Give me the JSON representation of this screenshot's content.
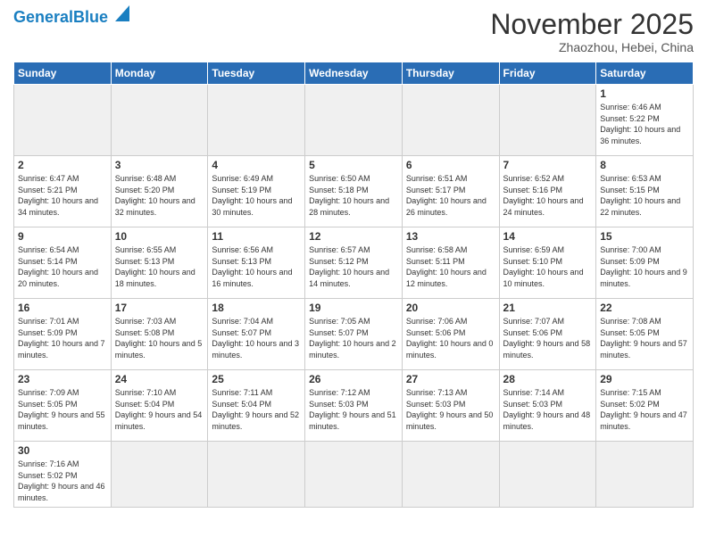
{
  "header": {
    "logo_general": "General",
    "logo_blue": "Blue",
    "title": "November 2025",
    "location": "Zhaozhou, Hebei, China"
  },
  "weekdays": [
    "Sunday",
    "Monday",
    "Tuesday",
    "Wednesday",
    "Thursday",
    "Friday",
    "Saturday"
  ],
  "weeks": [
    [
      {
        "day": "",
        "info": ""
      },
      {
        "day": "",
        "info": ""
      },
      {
        "day": "",
        "info": ""
      },
      {
        "day": "",
        "info": ""
      },
      {
        "day": "",
        "info": ""
      },
      {
        "day": "",
        "info": ""
      },
      {
        "day": "1",
        "info": "Sunrise: 6:46 AM\nSunset: 5:22 PM\nDaylight: 10 hours\nand 36 minutes."
      }
    ],
    [
      {
        "day": "2",
        "info": "Sunrise: 6:47 AM\nSunset: 5:21 PM\nDaylight: 10 hours\nand 34 minutes."
      },
      {
        "day": "3",
        "info": "Sunrise: 6:48 AM\nSunset: 5:20 PM\nDaylight: 10 hours\nand 32 minutes."
      },
      {
        "day": "4",
        "info": "Sunrise: 6:49 AM\nSunset: 5:19 PM\nDaylight: 10 hours\nand 30 minutes."
      },
      {
        "day": "5",
        "info": "Sunrise: 6:50 AM\nSunset: 5:18 PM\nDaylight: 10 hours\nand 28 minutes."
      },
      {
        "day": "6",
        "info": "Sunrise: 6:51 AM\nSunset: 5:17 PM\nDaylight: 10 hours\nand 26 minutes."
      },
      {
        "day": "7",
        "info": "Sunrise: 6:52 AM\nSunset: 5:16 PM\nDaylight: 10 hours\nand 24 minutes."
      },
      {
        "day": "8",
        "info": "Sunrise: 6:53 AM\nSunset: 5:15 PM\nDaylight: 10 hours\nand 22 minutes."
      }
    ],
    [
      {
        "day": "9",
        "info": "Sunrise: 6:54 AM\nSunset: 5:14 PM\nDaylight: 10 hours\nand 20 minutes."
      },
      {
        "day": "10",
        "info": "Sunrise: 6:55 AM\nSunset: 5:13 PM\nDaylight: 10 hours\nand 18 minutes."
      },
      {
        "day": "11",
        "info": "Sunrise: 6:56 AM\nSunset: 5:13 PM\nDaylight: 10 hours\nand 16 minutes."
      },
      {
        "day": "12",
        "info": "Sunrise: 6:57 AM\nSunset: 5:12 PM\nDaylight: 10 hours\nand 14 minutes."
      },
      {
        "day": "13",
        "info": "Sunrise: 6:58 AM\nSunset: 5:11 PM\nDaylight: 10 hours\nand 12 minutes."
      },
      {
        "day": "14",
        "info": "Sunrise: 6:59 AM\nSunset: 5:10 PM\nDaylight: 10 hours\nand 10 minutes."
      },
      {
        "day": "15",
        "info": "Sunrise: 7:00 AM\nSunset: 5:09 PM\nDaylight: 10 hours\nand 9 minutes."
      }
    ],
    [
      {
        "day": "16",
        "info": "Sunrise: 7:01 AM\nSunset: 5:09 PM\nDaylight: 10 hours\nand 7 minutes."
      },
      {
        "day": "17",
        "info": "Sunrise: 7:03 AM\nSunset: 5:08 PM\nDaylight: 10 hours\nand 5 minutes."
      },
      {
        "day": "18",
        "info": "Sunrise: 7:04 AM\nSunset: 5:07 PM\nDaylight: 10 hours\nand 3 minutes."
      },
      {
        "day": "19",
        "info": "Sunrise: 7:05 AM\nSunset: 5:07 PM\nDaylight: 10 hours\nand 2 minutes."
      },
      {
        "day": "20",
        "info": "Sunrise: 7:06 AM\nSunset: 5:06 PM\nDaylight: 10 hours\nand 0 minutes."
      },
      {
        "day": "21",
        "info": "Sunrise: 7:07 AM\nSunset: 5:06 PM\nDaylight: 9 hours\nand 58 minutes."
      },
      {
        "day": "22",
        "info": "Sunrise: 7:08 AM\nSunset: 5:05 PM\nDaylight: 9 hours\nand 57 minutes."
      }
    ],
    [
      {
        "day": "23",
        "info": "Sunrise: 7:09 AM\nSunset: 5:05 PM\nDaylight: 9 hours\nand 55 minutes."
      },
      {
        "day": "24",
        "info": "Sunrise: 7:10 AM\nSunset: 5:04 PM\nDaylight: 9 hours\nand 54 minutes."
      },
      {
        "day": "25",
        "info": "Sunrise: 7:11 AM\nSunset: 5:04 PM\nDaylight: 9 hours\nand 52 minutes."
      },
      {
        "day": "26",
        "info": "Sunrise: 7:12 AM\nSunset: 5:03 PM\nDaylight: 9 hours\nand 51 minutes."
      },
      {
        "day": "27",
        "info": "Sunrise: 7:13 AM\nSunset: 5:03 PM\nDaylight: 9 hours\nand 50 minutes."
      },
      {
        "day": "28",
        "info": "Sunrise: 7:14 AM\nSunset: 5:03 PM\nDaylight: 9 hours\nand 48 minutes."
      },
      {
        "day": "29",
        "info": "Sunrise: 7:15 AM\nSunset: 5:02 PM\nDaylight: 9 hours\nand 47 minutes."
      }
    ],
    [
      {
        "day": "30",
        "info": "Sunrise: 7:16 AM\nSunset: 5:02 PM\nDaylight: 9 hours\nand 46 minutes."
      },
      {
        "day": "",
        "info": ""
      },
      {
        "day": "",
        "info": ""
      },
      {
        "day": "",
        "info": ""
      },
      {
        "day": "",
        "info": ""
      },
      {
        "day": "",
        "info": ""
      },
      {
        "day": "",
        "info": ""
      }
    ]
  ]
}
